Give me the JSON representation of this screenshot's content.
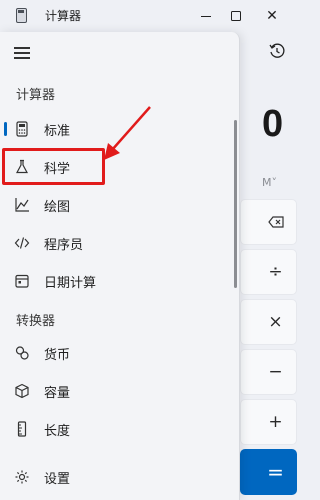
{
  "window": {
    "title": "计算器",
    "minimize_glyph": "",
    "close_glyph": "✕"
  },
  "calculator": {
    "display_value": "0",
    "memory_label": "M˅",
    "keys": {
      "backspace": "⌫",
      "divide": "÷",
      "multiply": "×",
      "subtract": "−",
      "add": "+",
      "equals": "="
    }
  },
  "nav": {
    "section_calculators": "计算器",
    "section_converters": "转换器",
    "items": [
      {
        "label": "标准",
        "icon": "calculator-icon",
        "active": true
      },
      {
        "label": "科学",
        "icon": "flask-icon",
        "active": false
      },
      {
        "label": "绘图",
        "icon": "graph-icon",
        "active": false
      },
      {
        "label": "程序员",
        "icon": "code-icon",
        "active": false
      },
      {
        "label": "日期计算",
        "icon": "calendar-icon",
        "active": false
      }
    ],
    "converters": [
      {
        "label": "货币",
        "icon": "currency-icon"
      },
      {
        "label": "容量",
        "icon": "cube-icon"
      },
      {
        "label": "长度",
        "icon": "ruler-icon"
      }
    ],
    "settings_label": "设置"
  },
  "colors": {
    "accent": "#0067c0",
    "highlight_red": "#e11b1b"
  }
}
